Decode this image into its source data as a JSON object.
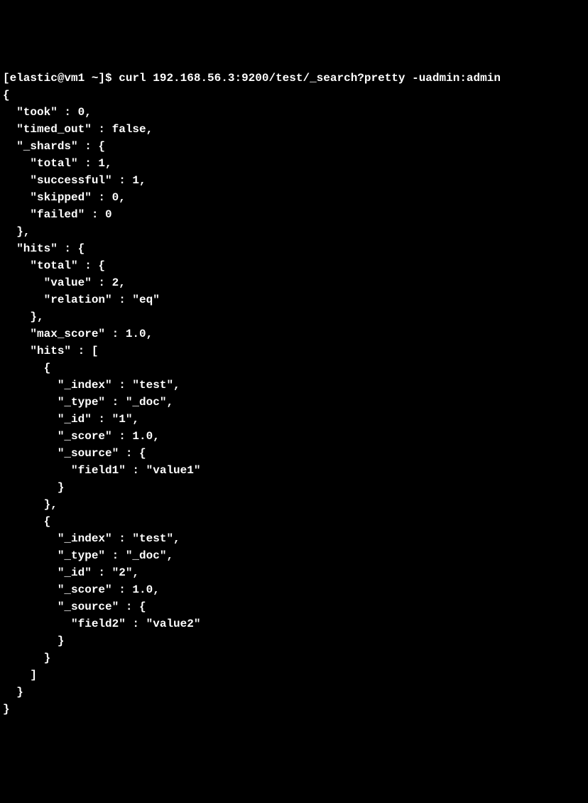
{
  "prompt": {
    "user_host": "[elastic@vm1 ~]$ ",
    "command": "curl 192.168.56.3:9200/test/_search?pretty -uadmin:admin"
  },
  "output": "{\n  \"took\" : 0,\n  \"timed_out\" : false,\n  \"_shards\" : {\n    \"total\" : 1,\n    \"successful\" : 1,\n    \"skipped\" : 0,\n    \"failed\" : 0\n  },\n  \"hits\" : {\n    \"total\" : {\n      \"value\" : 2,\n      \"relation\" : \"eq\"\n    },\n    \"max_score\" : 1.0,\n    \"hits\" : [\n      {\n        \"_index\" : \"test\",\n        \"_type\" : \"_doc\",\n        \"_id\" : \"1\",\n        \"_score\" : 1.0,\n        \"_source\" : {\n          \"field1\" : \"value1\"\n        }\n      },\n      {\n        \"_index\" : \"test\",\n        \"_type\" : \"_doc\",\n        \"_id\" : \"2\",\n        \"_score\" : 1.0,\n        \"_source\" : {\n          \"field2\" : \"value2\"\n        }\n      }\n    ]\n  }\n}"
}
